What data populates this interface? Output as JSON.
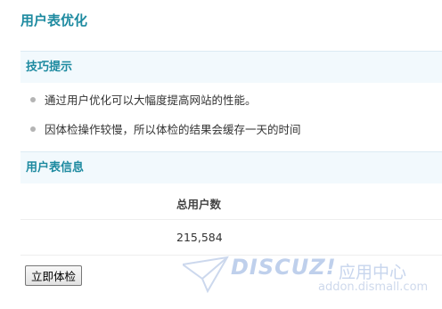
{
  "page_title": "用户表优化",
  "tips_section": {
    "title": "技巧提示",
    "items": [
      "通过用户优化可以大幅度提高网站的性能。",
      "因体检操作较慢，所以体检的结果会缓存一天的时间"
    ]
  },
  "info_section": {
    "title": "用户表信息",
    "table": {
      "headers": [
        "总用户数"
      ],
      "rows": [
        [
          "215,584"
        ]
      ]
    }
  },
  "actions": {
    "check_label": "立即体检"
  },
  "watermark": {
    "brand": "DISCUZ!",
    "subtitle": "应用中心",
    "url": "addon.dismall.com"
  },
  "colors": {
    "accent": "#1d8aa0",
    "section_bg": "#f2f9fd"
  }
}
